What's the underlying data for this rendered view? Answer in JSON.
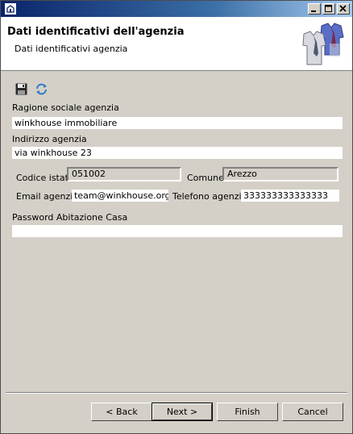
{
  "window": {
    "icons": [
      "app-icon",
      "minimize-icon",
      "maximize-icon",
      "close-icon"
    ]
  },
  "banner": {
    "title": "Dati identificativi dell'agenzia",
    "subtitle": "Dati identificativi agenzia",
    "image": "shirts-image"
  },
  "toolbar": {
    "icons": [
      "save-icon",
      "refresh-icon"
    ]
  },
  "form": {
    "ragione_label": "Ragione sociale agenzia",
    "ragione_value": "winkhouse immobiliare",
    "indirizzo_label": "Indirizzo agenzia",
    "indirizzo_value": "via winkhouse 23",
    "istat_label": "Codice istat",
    "istat_value": "051002",
    "comune_label": "Comune",
    "comune_value": "Arezzo",
    "email_label": "Email agenzia",
    "email_value": "team@winkhouse.org",
    "telefono_label": "Telefono agenzia",
    "telefono_value": "333333333333333",
    "password_label": "Password Abitazione Casa",
    "password_value": ""
  },
  "buttons": {
    "back": "< Back",
    "next": "Next >",
    "finish": "Finish",
    "cancel": "Cancel"
  },
  "colors": {
    "title_start": "#0a246a",
    "title_end": "#a6caf0",
    "dialog_bg": "#d4d0c8"
  }
}
